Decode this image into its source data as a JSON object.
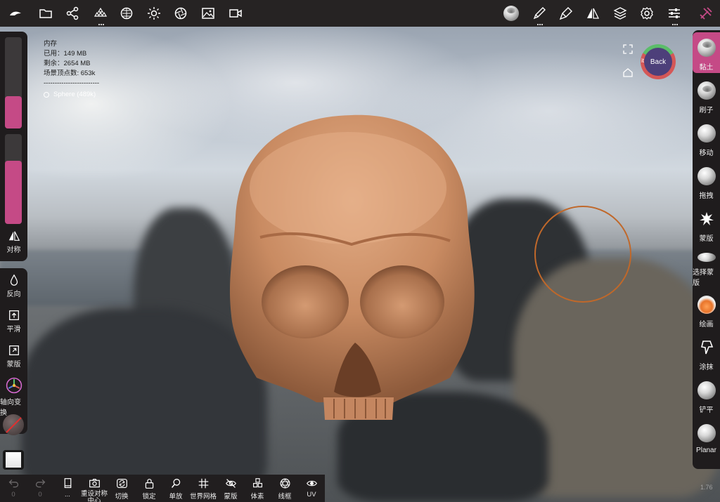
{
  "app": {
    "version": "1.76"
  },
  "top_toolbar": {
    "left_icons": [
      "logo-icon",
      "folder-icon",
      "scene-graph-icon",
      "primitives-icon",
      "material-sphere-icon",
      "light-icon",
      "camera-aperture-icon",
      "image-icon",
      "video-icon"
    ],
    "right_icons": [
      "material-ball-icon",
      "paint-brush-icon",
      "stroke-settings-icon",
      "symmetry-icon",
      "layers-icon",
      "settings-gear-icon",
      "sliders-icon",
      "tools-icon"
    ],
    "accent_color": "#c54a86"
  },
  "info_overlay": {
    "title": "内存",
    "used": "已用：149 MB",
    "remaining": "剩余：2654 MB",
    "vertices": "场景顶点数: 653k",
    "divider": "-------------------------",
    "mesh": "Sphere (489k)"
  },
  "gizmo": {
    "label": "Back",
    "side_label": "it"
  },
  "left_panel": {
    "symmetry_label": "对称",
    "radius_slider_value": 0.35,
    "intensity_slider_value": 0.7,
    "buttons": [
      {
        "label": "反向",
        "icon": "drop-icon"
      },
      {
        "label": "平滑",
        "icon": "smooth-icon"
      },
      {
        "label": "蒙版",
        "icon": "mask-icon"
      },
      {
        "label": "轴向变换",
        "icon": "axis-gizmo-icon"
      }
    ]
  },
  "right_tools": [
    {
      "label": "黏土",
      "active": true
    },
    {
      "label": "刷子",
      "active": false
    },
    {
      "label": "移动",
      "active": false
    },
    {
      "label": "拖拽",
      "active": false
    },
    {
      "label": "蒙版",
      "active": false
    },
    {
      "label": "选择蒙版",
      "active": false
    },
    {
      "label": "绘画",
      "active": false
    },
    {
      "label": "涂抹",
      "active": false
    },
    {
      "label": "铲平",
      "active": false
    },
    {
      "label": "Planar",
      "active": false
    }
  ],
  "bottom_bar": {
    "undo_count": "0",
    "redo_count": "0",
    "items": [
      {
        "label": "...",
        "icon": "history-icon"
      },
      {
        "label": "重设对称中心",
        "icon": "camera-icon"
      },
      {
        "label": "切换",
        "icon": "switch-icon"
      },
      {
        "label": "锁定",
        "icon": "lock-icon"
      },
      {
        "label": "单放",
        "icon": "magnifier-icon"
      },
      {
        "label": "世界网格",
        "icon": "grid-icon"
      },
      {
        "label": "蒙版",
        "icon": "eye-off-icon"
      },
      {
        "label": "体素",
        "icon": "voxel-icon"
      },
      {
        "label": "线框",
        "icon": "wireframe-icon"
      },
      {
        "label": "UV",
        "icon": "uv-icon"
      }
    ]
  }
}
